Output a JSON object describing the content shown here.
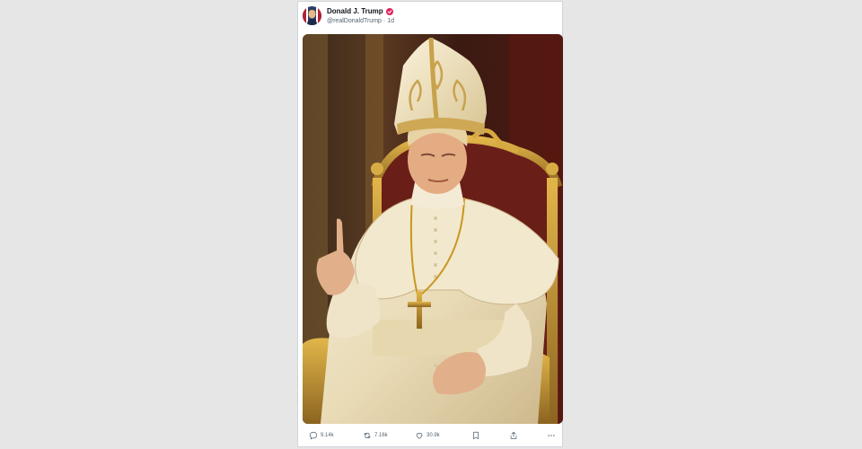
{
  "post": {
    "author": {
      "display_name": "Donald J. Trump",
      "handle": "@realDonaldTrump",
      "separator": "·",
      "age": "1d",
      "verified": true
    },
    "media": {
      "icon": "image"
    },
    "actions": {
      "replies": "9.14k",
      "reposts": "7.16k",
      "likes": "30.9k",
      "icons": [
        "reply-icon",
        "repost-icon",
        "like-icon",
        "bookmark-icon",
        "share-icon",
        "more-icon"
      ]
    }
  },
  "colors": {
    "background": "#e6e6e6",
    "card": "#ffffff",
    "text_primary": "#0f1419",
    "text_secondary": "#536471",
    "verified_badge": "#e0245e"
  }
}
